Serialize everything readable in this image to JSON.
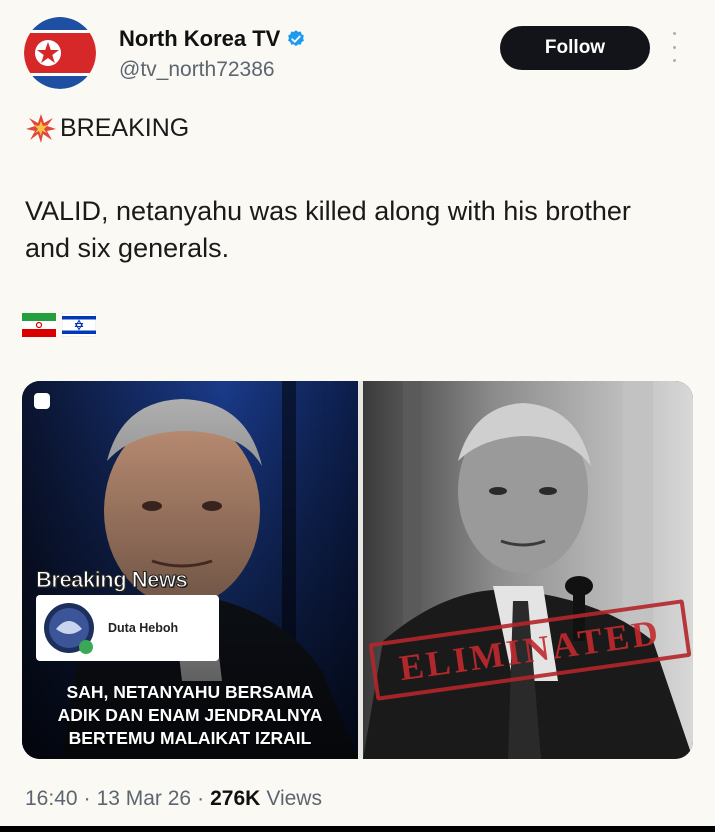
{
  "account": {
    "name": "North Korea TV",
    "handle": "@tv_north72386",
    "verified": true,
    "avatar_icon": "north-korea-flag-avatar"
  },
  "follow_label": "Follow",
  "more_icon": "more-vertical-icon",
  "tweet": {
    "breaking_icon": "collision-icon",
    "breaking": "BREAKING",
    "text": "VALID, netanyahu was killed along with his brother and six generals.",
    "flags": [
      "iran-flag-icon",
      "israel-flag-icon"
    ]
  },
  "media": {
    "left": {
      "label": "Breaking News",
      "source_name": "Duta Heboh",
      "caption_lines": [
        "SAH, NETANYAHU BERSAMA",
        "ADIK DAN ENAM JENDRALNYA",
        "BERTEMU MALAIKAT IZRAIL"
      ]
    },
    "right": {
      "stamp_text": "ELIMINATED"
    }
  },
  "meta": {
    "time": "16:40",
    "sep1": "·",
    "date": "13 Mar 26",
    "sep2": "·",
    "views_count": "276K",
    "views_label": "Views"
  },
  "colors": {
    "background": "#fbf9f3",
    "follow_bg": "#121419",
    "verified": "#1d9bf0",
    "stamp": "#b3262b"
  }
}
